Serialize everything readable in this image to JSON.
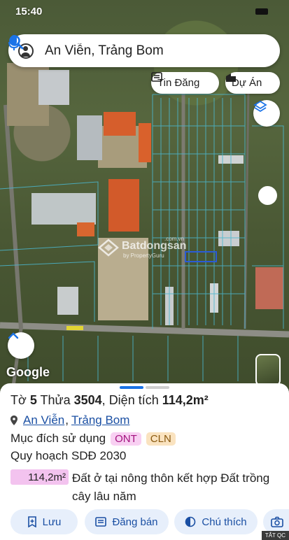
{
  "status": {
    "time": "15:40"
  },
  "search": {
    "value": "An Viễn, Trảng Bom"
  },
  "chips": {
    "tin_dang": "Tin Đăng",
    "du_an": "Dự Án"
  },
  "watermark": {
    "brand": "Batdongsan",
    "sub": "by PropertyGuru",
    "com": ".com.vn"
  },
  "map": {
    "attribution": "Google"
  },
  "parcel": {
    "to_label": "Tờ",
    "to_value": "5",
    "thua_label": "Thửa",
    "thua_value": "3504",
    "dien_tich_label": "Diện tích",
    "dien_tich_value": "114,2m²",
    "location_ward": "An Viễn",
    "location_district": "Trảng Bom",
    "purpose_label": "Mục đích sử dụng",
    "purpose_tags": [
      "ONT",
      "CLN"
    ],
    "planning": "Quy hoạch SDĐ 2030",
    "area_chip": "114,2m²",
    "area_desc": "Đất ở tại nông thôn kết hợp Đất trồng cây lâu năm"
  },
  "actions": {
    "save": "Lưu",
    "post": "Đăng bán",
    "favorite": "Chú thích"
  },
  "ad_label": "TẮT QC",
  "colors": {
    "accent": "#1a73e8",
    "link": "#1a4fa3",
    "ont_bg": "#f8d0f2",
    "cln_bg": "#fae3c0",
    "button_bg": "#e7effb"
  },
  "icons": [
    "account-icon",
    "search-icon",
    "mic-icon",
    "news-icon",
    "building-icon",
    "layers-icon",
    "chevron-up-icon",
    "pin-icon",
    "bookmark-plus-icon",
    "card-icon",
    "contrast-icon",
    "camera-icon"
  ]
}
